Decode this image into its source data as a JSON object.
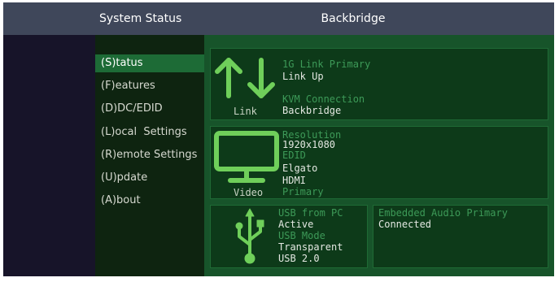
{
  "header": {
    "title": "System Status",
    "device": "Backbridge"
  },
  "menu": {
    "items": [
      {
        "label": "(S)tatus",
        "active": true
      },
      {
        "label": "(F)eatures"
      },
      {
        "label": "(D)DC/EDID"
      },
      {
        "label": "(L)ocal  Settings"
      },
      {
        "label": "(R)emote Settings"
      },
      {
        "label": "(U)pdate"
      },
      {
        "label": "(A)bout"
      }
    ]
  },
  "link": {
    "icon": "up-down-arrows-icon",
    "caption": "Link",
    "link_label": "1G Link Primary",
    "link_value": "Link Up",
    "kvm_label": "KVM Connection",
    "kvm_value": "Backbridge"
  },
  "video": {
    "icon": "monitor-icon",
    "caption": "Video",
    "resolution_label": "Resolution",
    "resolution_value": "1920x1080",
    "edid_label": "EDID",
    "edid_value": "Elgato",
    "edid_type": "HDMI",
    "edid_source": "Primary"
  },
  "usb": {
    "icon": "usb-icon",
    "from_pc_label": "USB from PC",
    "from_pc_value": "Active",
    "mode_label": "USB Mode",
    "mode_value": "Transparent",
    "version_value": "USB 2.0"
  },
  "audio": {
    "label": "Embedded Audio Primary",
    "value": "Connected"
  },
  "colors": {
    "accent_green": "#6fcf5a",
    "label_green": "#3d9a58",
    "active_menu": "#1d6b36",
    "header_bg": "#3f475a"
  }
}
